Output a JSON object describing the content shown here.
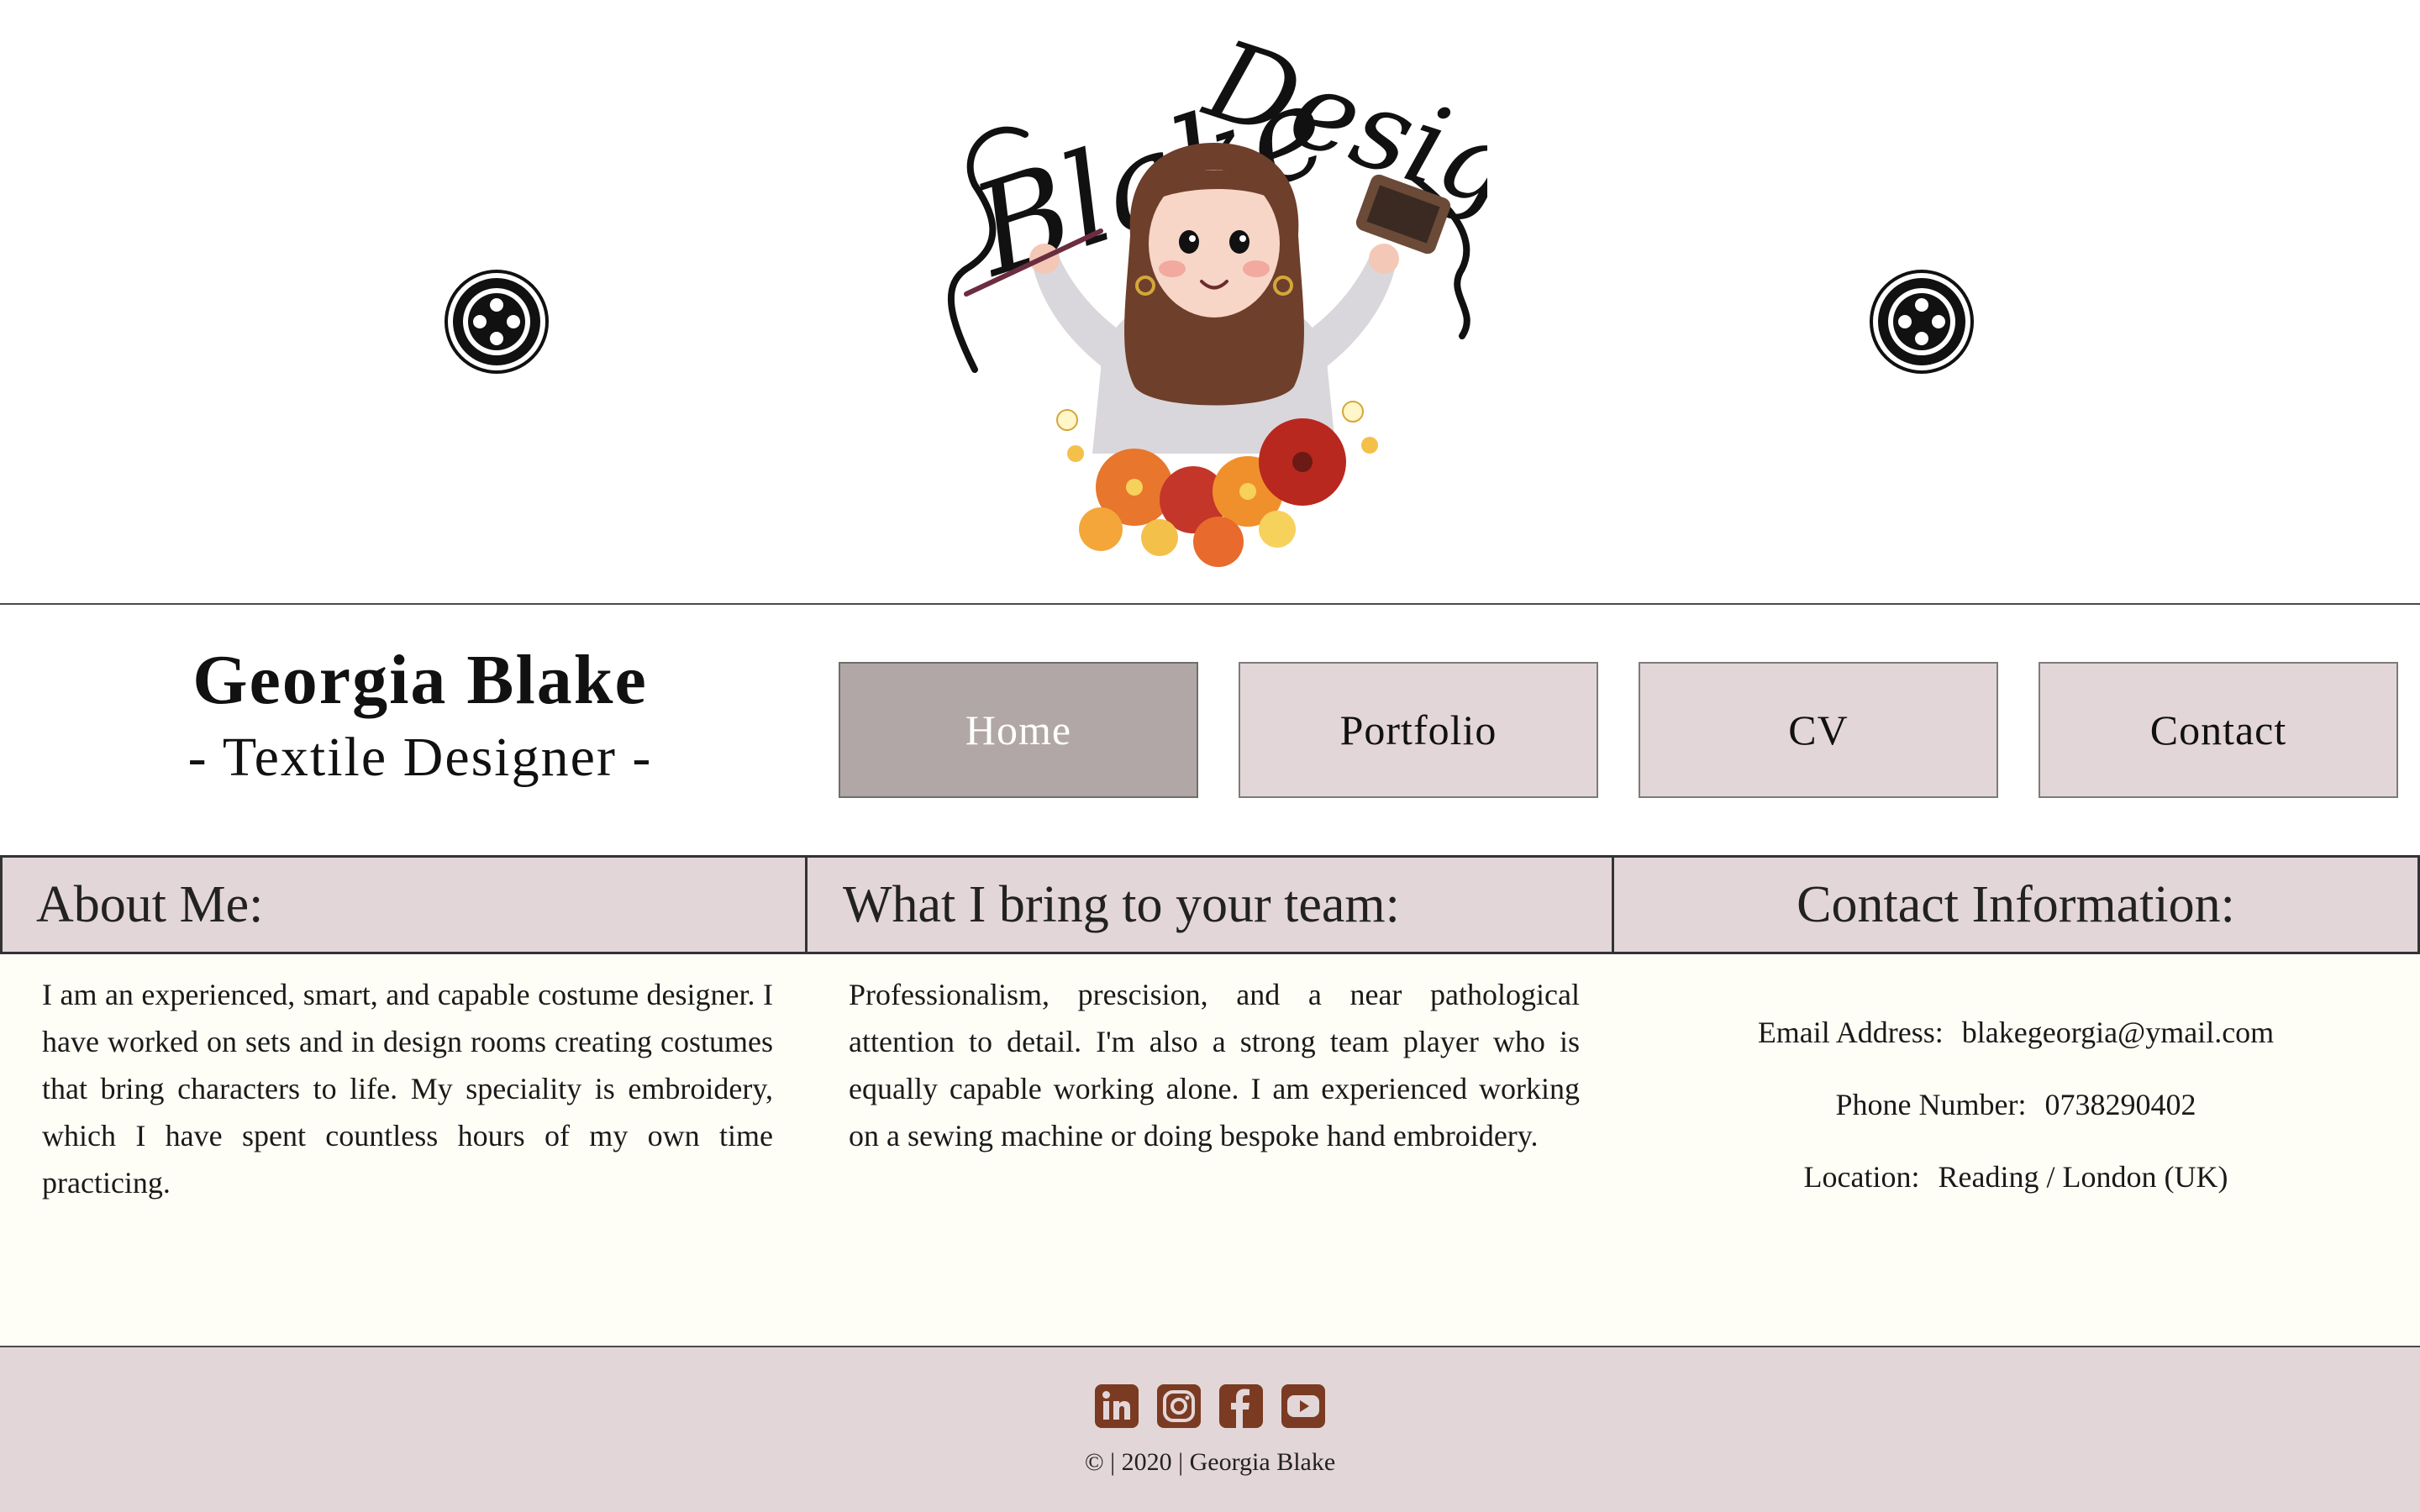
{
  "header": {
    "logo_text": "Blake Designs"
  },
  "identity": {
    "name": "Georgia Blake",
    "subtitle": "- Textile Designer -"
  },
  "nav": {
    "items": [
      {
        "label": "Home",
        "active": true
      },
      {
        "label": "Portfolio",
        "active": false
      },
      {
        "label": "CV",
        "active": false
      },
      {
        "label": "Contact",
        "active": false
      }
    ]
  },
  "columns": {
    "about": {
      "heading": "About Me:",
      "text": "I am an experienced, smart, and capable costume designer. I have worked on sets and in design rooms creating costumes that bring characters to life. My speciality is embroidery, which I have spent countless hours of my own time practicing."
    },
    "team": {
      "heading": "What I bring to your team:",
      "text": "Professionalism, prescision, and a near pathological attention to detail. I'm also a strong team player who is equally capable working alone. I am experienced working on a sewing machine or doing bespoke hand embroidery."
    },
    "contact": {
      "heading": "Contact Information:",
      "rows": [
        {
          "label": "Email Address:",
          "value": "blakegeorgia@ymail.com"
        },
        {
          "label": "Phone Number:",
          "value": "0738290402"
        },
        {
          "label": "Location:",
          "value": "Reading / London (UK)"
        }
      ]
    }
  },
  "footer": {
    "socials": [
      "linkedin-icon",
      "instagram-icon",
      "facebook-icon",
      "youtube-icon"
    ],
    "copyright": "© | 2020 | Georgia Blake"
  },
  "colors": {
    "nav_bg": "#e3d6d8",
    "nav_active": "#b1a7a7",
    "content_bg": "#fffef6",
    "social_icon": "#7a3b22"
  }
}
